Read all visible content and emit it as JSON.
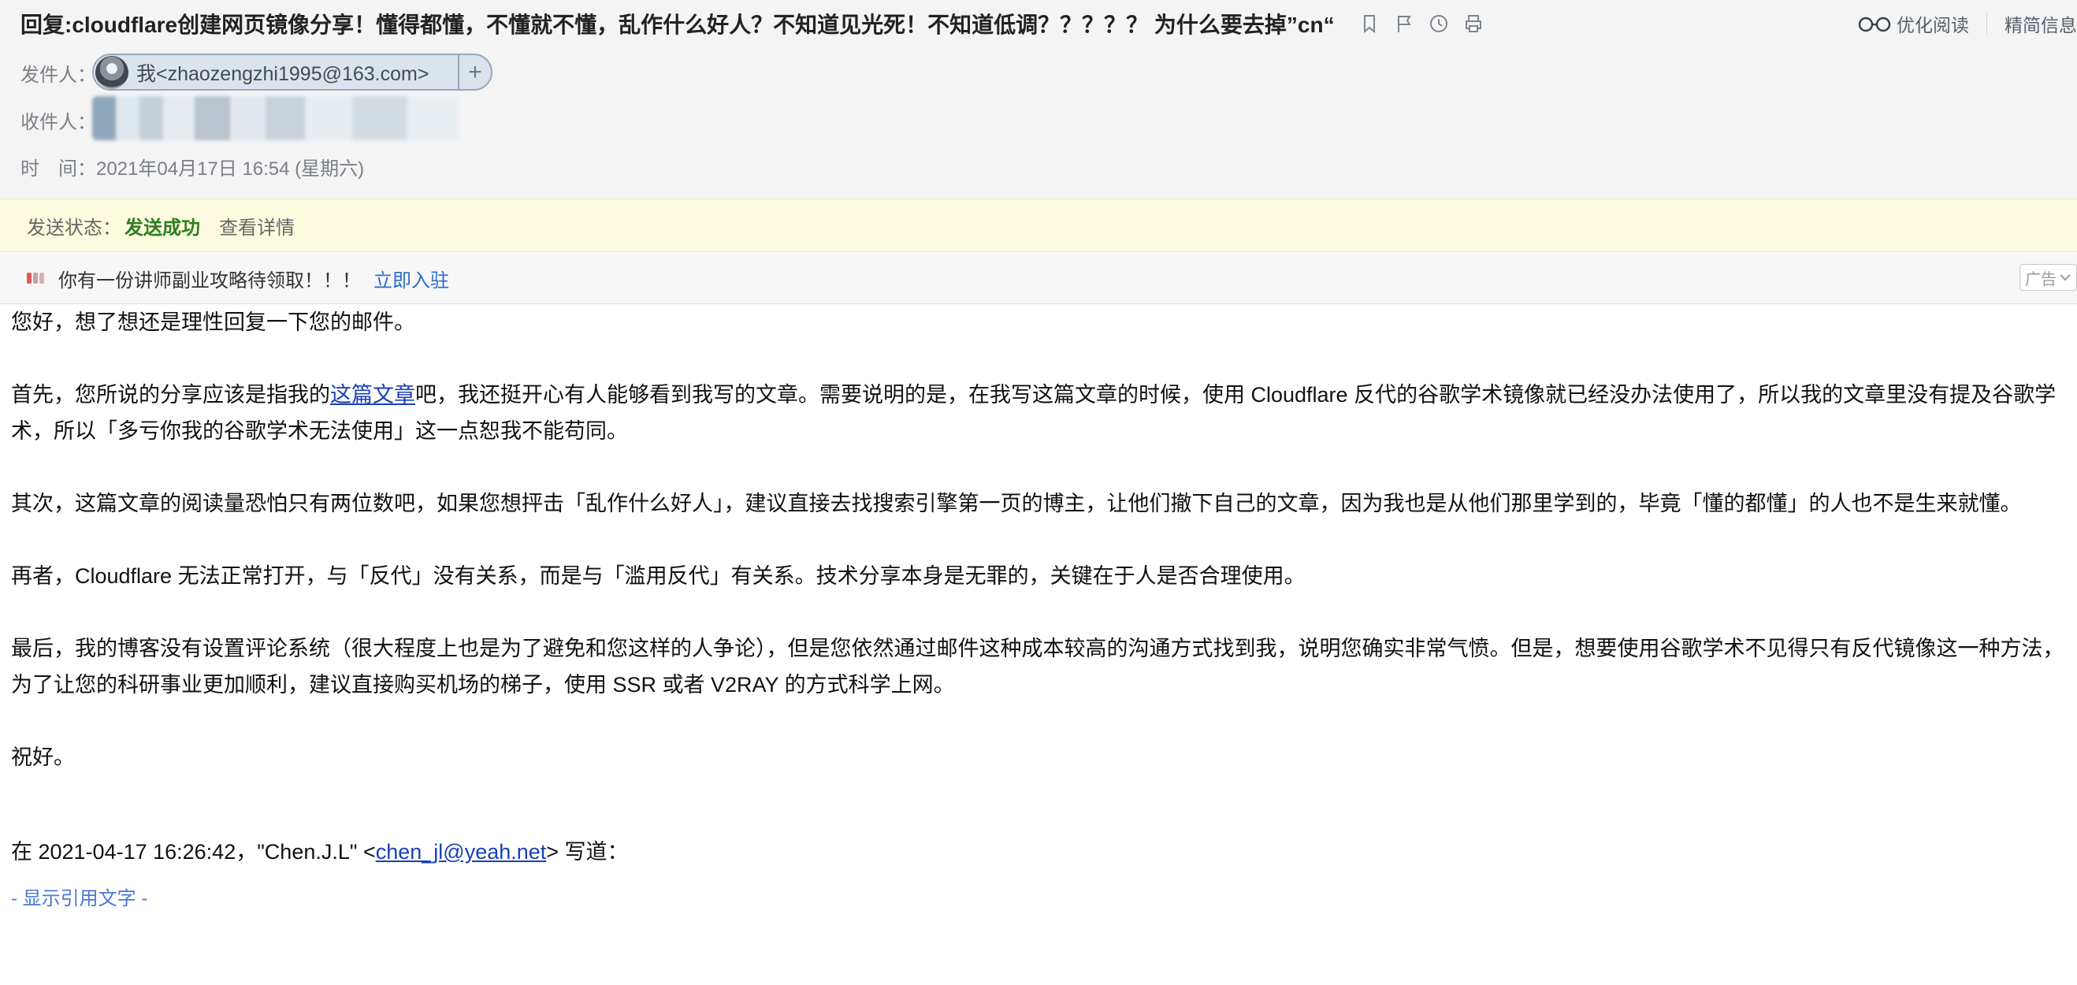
{
  "header": {
    "subject": "回复:cloudflare创建网页镜像分享！懂得都懂，不懂就不懂，乱作什么好人？不知道见光死！不知道低调？？？？？ 为什么要去掉”cn“",
    "subject_icons": [
      "bookmark-icon",
      "flag-icon",
      "clock-icon",
      "print-icon"
    ],
    "tools": {
      "optimize_read": "优化阅读",
      "concise_info": "精简信息"
    },
    "from_label": "发件人：",
    "from_value": "我<zhaozengzhi1995@163.com>",
    "add_contact": "+",
    "to_label": "收件人：",
    "time_label": "时　间：",
    "time_value": "2021年04月17日 16:54 (星期六)"
  },
  "status": {
    "label": "发送状态：",
    "value": "发送成功",
    "detail": "查看详情"
  },
  "ad": {
    "text": "你有一份讲师副业攻略待领取！！！",
    "link": "立即入驻",
    "tag": "广告"
  },
  "body": {
    "p1": "您好，想了想还是理性回复一下您的邮件。",
    "p2_before": "首先，您所说的分享应该是指我的",
    "p2_link": "这篇文章",
    "p2_after": "吧，我还挺开心有人能够看到我写的文章。需要说明的是，在我写这篇文章的时候，使用 Cloudflare 反代的谷歌学术镜像就已经没办法使用了，所以我的文章里没有提及谷歌学术，所以「多亏你我的谷歌学术无法使用」这一点恕我不能苟同。",
    "p3": "其次，这篇文章的阅读量恐怕只有两位数吧，如果您想抨击「乱作什么好人」，建议直接去找搜索引擎第一页的博主，让他们撤下自己的文章，因为我也是从他们那里学到的，毕竟「懂的都懂」的人也不是生来就懂。",
    "p4": "再者，Cloudflare 无法正常打开，与「反代」没有关系，而是与「滥用反代」有关系。技术分享本身是无罪的，关键在于人是否合理使用。",
    "p5": "最后，我的博客没有设置评论系统（很大程度上也是为了避免和您这样的人争论），但是您依然通过邮件这种成本较高的沟通方式找到我，说明您确实非常气愤。但是，想要使用谷歌学术不见得只有反代镜像这一种方法，为了让您的科研事业更加顺利，建议直接购买机场的梯子，使用 SSR 或者 V2RAY 的方式科学上网。",
    "p6": "祝好。",
    "quote_before": "在 2021-04-17 16:26:42，\"Chen.J.L\" <",
    "quote_email": "chen_jl@yeah.net",
    "quote_after": "> 写道：",
    "show_quote": "- 显示引用文字 -"
  },
  "colors": {
    "accent_link": "#1a3fb8",
    "status_success": "#2e7d1f",
    "status_bar_bg": "#fcfbdf",
    "header_bg": "#f4f4f5"
  }
}
